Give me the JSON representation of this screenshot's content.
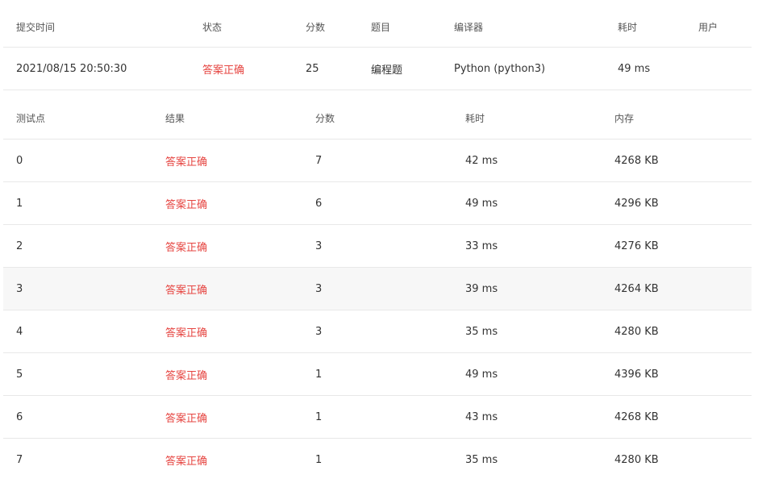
{
  "summary": {
    "headers": {
      "submit_time": "提交时间",
      "status": "状态",
      "score": "分数",
      "problem": "题目",
      "compiler": "编译器",
      "time": "耗时",
      "user": "用户"
    },
    "row": {
      "submit_time": "2021/08/15 20:50:30",
      "status": "答案正确",
      "score": "25",
      "problem": "编程题",
      "compiler": "Python (python3)",
      "time": "49 ms",
      "user": ""
    }
  },
  "cases": {
    "headers": {
      "case": "测试点",
      "result": "结果",
      "score": "分数",
      "time": "耗时",
      "memory": "内存"
    },
    "rows": [
      {
        "case": "0",
        "result": "答案正确",
        "score": "7",
        "time": "42 ms",
        "memory": "4268 KB"
      },
      {
        "case": "1",
        "result": "答案正确",
        "score": "6",
        "time": "49 ms",
        "memory": "4296 KB"
      },
      {
        "case": "2",
        "result": "答案正确",
        "score": "3",
        "time": "33 ms",
        "memory": "4276 KB"
      },
      {
        "case": "3",
        "result": "答案正确",
        "score": "3",
        "time": "39 ms",
        "memory": "4264 KB"
      },
      {
        "case": "4",
        "result": "答案正确",
        "score": "3",
        "time": "35 ms",
        "memory": "4280 KB"
      },
      {
        "case": "5",
        "result": "答案正确",
        "score": "1",
        "time": "49 ms",
        "memory": "4396 KB"
      },
      {
        "case": "6",
        "result": "答案正确",
        "score": "1",
        "time": "43 ms",
        "memory": "4268 KB"
      },
      {
        "case": "7",
        "result": "答案正确",
        "score": "1",
        "time": "35 ms",
        "memory": "4280 KB"
      }
    ]
  },
  "colors": {
    "accepted": "#e64541",
    "hover_row": "#f7f7f7",
    "border": "#e8e8e8"
  }
}
